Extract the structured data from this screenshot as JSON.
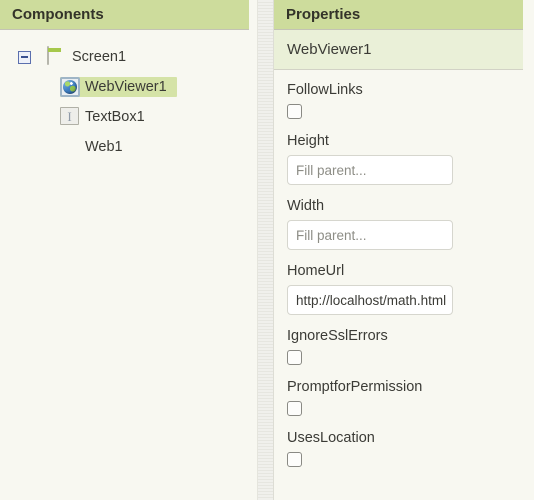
{
  "components_panel": {
    "header": "Components",
    "tree": [
      {
        "label": "Screen1",
        "icon": "screen-icon",
        "depth": 0,
        "toggle": "collapse-minus-icon",
        "selected": false
      },
      {
        "label": "WebViewer1",
        "icon": "webviewer-globe-icon",
        "depth": 1,
        "selected": true
      },
      {
        "label": "TextBox1",
        "icon": "textbox-icon",
        "icon_glyph": "I",
        "depth": 1,
        "selected": false
      },
      {
        "label": "Web1",
        "icon": "web-globe-icon",
        "depth": 1,
        "selected": false
      }
    ]
  },
  "properties_panel": {
    "header": "Properties",
    "selected_component": "WebViewer1",
    "properties": [
      {
        "name": "FollowLinks",
        "type": "checkbox",
        "checked": false
      },
      {
        "name": "Height",
        "type": "text",
        "value": "",
        "placeholder": "Fill parent..."
      },
      {
        "name": "Width",
        "type": "text",
        "value": "",
        "placeholder": "Fill parent..."
      },
      {
        "name": "HomeUrl",
        "type": "text",
        "value": "http://localhost/math.html",
        "placeholder": ""
      },
      {
        "name": "IgnoreSslErrors",
        "type": "checkbox",
        "checked": false
      },
      {
        "name": "PromptforPermission",
        "type": "checkbox",
        "checked": false
      },
      {
        "name": "UsesLocation",
        "type": "checkbox",
        "checked": false
      }
    ]
  },
  "colors": {
    "header_green": "#cddc9c",
    "selected_row_green": "#d5e3a7",
    "selected_name_green": "#eaf0d8",
    "background": "#f8f8f1",
    "text": "#3b3b36",
    "placeholder": "#8d8d86"
  }
}
